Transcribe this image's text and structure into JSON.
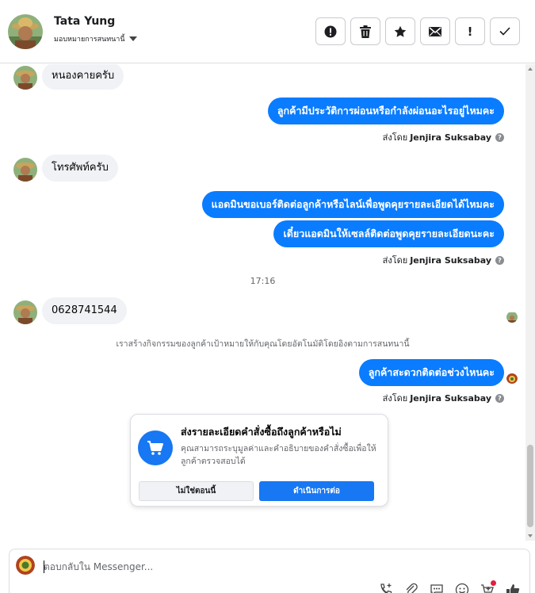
{
  "header": {
    "name": "Tata Yung",
    "assign_label": "มอบหมายการสนทนานี้",
    "actions": [
      {
        "icon": "alert-circle-icon",
        "glyph": ""
      },
      {
        "icon": "trash-icon",
        "glyph": ""
      },
      {
        "icon": "star-icon",
        "glyph": ""
      },
      {
        "icon": "mail-icon",
        "glyph": ""
      },
      {
        "icon": "exclamation-icon",
        "glyph": "!"
      },
      {
        "icon": "check-icon",
        "glyph": "✓"
      }
    ]
  },
  "messages": {
    "incoming_1": "หนองคายครับ",
    "outgoing_1": "ลูกค้ามีประวัติการผ่อนหรือกำลังผ่อนอะไรอยู่ไหมคะ",
    "incoming_2": "โทรศัพท์ครับ",
    "outgoing_2": "แอดมินขอเบอร์ติดต่อลูกค้าหรือไลน์เพื่อพูดคุยรายละเอียดได้ไหมคะ",
    "outgoing_3": "เดี๋ยวแอดมินให้เซลล์ติดต่อพูดคุยรายละเอียดนะคะ",
    "time": "17:16",
    "incoming_3": "0628741544",
    "system_note": "เราสร้างกิจกรรมของลูกค้าเป้าหมายให้กับคุณโดยอัตโนมัติโดยอิงตามการสนทนานี้",
    "outgoing_4": "ลูกค้าสะดวกติดต่อช่วงไหนคะ",
    "sent_prefix": "ส่งโดย",
    "sender": "Jenjira Suksabay",
    "help_glyph": "?"
  },
  "order_card": {
    "title": "ส่งรายละเอียดคำสั่งซื้อถึงลูกค้าหรือไม่",
    "description": "คุณสามารถระบุมูลค่าและคำอธิบายของคำสั่งซื้อเพื่อให้ลูกค้าตรวจสอบได้",
    "decline_label": "ไม่ใช่ตอนนี้",
    "confirm_label": "ดำเนินการต่อ"
  },
  "composer": {
    "placeholder": "ตอบกลับใน Messenger..."
  },
  "colors": {
    "accent": "#0a7cff",
    "bubble_in": "#f0f2f5",
    "muted": "#65676b"
  }
}
